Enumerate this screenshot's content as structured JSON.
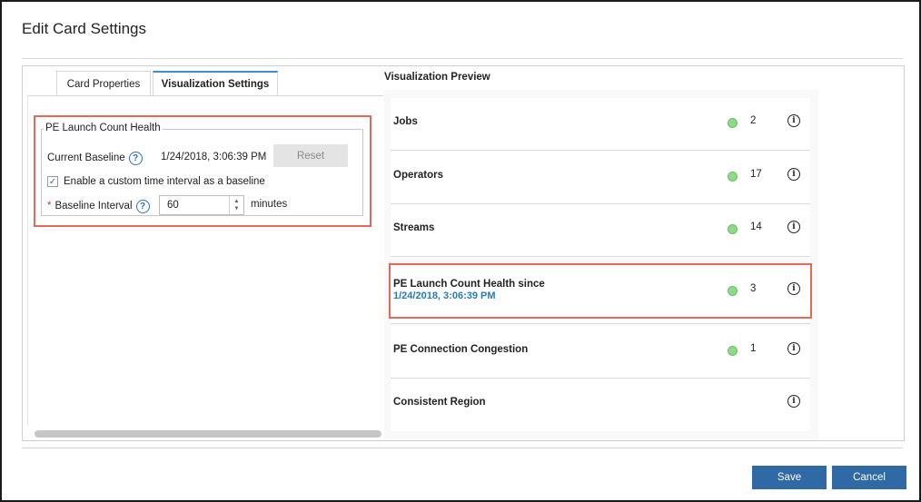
{
  "dialog": {
    "title": "Edit Card Settings"
  },
  "tabs": [
    {
      "label": "Card Properties"
    },
    {
      "label": "Visualization Settings"
    }
  ],
  "settings": {
    "legend": "PE Launch Count Health",
    "baseline_label": "Current Baseline",
    "baseline_value": "1/24/2018, 3:06:39 PM",
    "reset_label": "Reset",
    "checkbox_label": "Enable a custom time interval as a baseline",
    "checkbox_checked": true,
    "required_marker": "*",
    "interval_label": "Baseline Interval",
    "interval_value": "60",
    "interval_unit": "minutes",
    "help_glyph": "?"
  },
  "preview": {
    "title": "Visualization Preview",
    "info_glyph": "i",
    "status_color": "#8fd98a",
    "cards": [
      {
        "label": "Jobs",
        "count": "2",
        "status": "green"
      },
      {
        "label": "Operators",
        "count": "17",
        "status": "green"
      },
      {
        "label": "Streams",
        "count": "14",
        "status": "green"
      },
      {
        "label": "PE Launch Count Health since",
        "sub": "1/24/2018, 3:06:39 PM",
        "count": "3",
        "status": "green"
      },
      {
        "label": "PE Connection Congestion",
        "count": "1",
        "status": "green"
      },
      {
        "label": "Consistent Region",
        "count": "",
        "status": "none"
      }
    ]
  },
  "footer": {
    "save_label": "Save",
    "cancel_label": "Cancel"
  },
  "colors": {
    "accent": "#2f6aa6",
    "highlight": "#e26a5a",
    "link": "#2a7ab5"
  }
}
